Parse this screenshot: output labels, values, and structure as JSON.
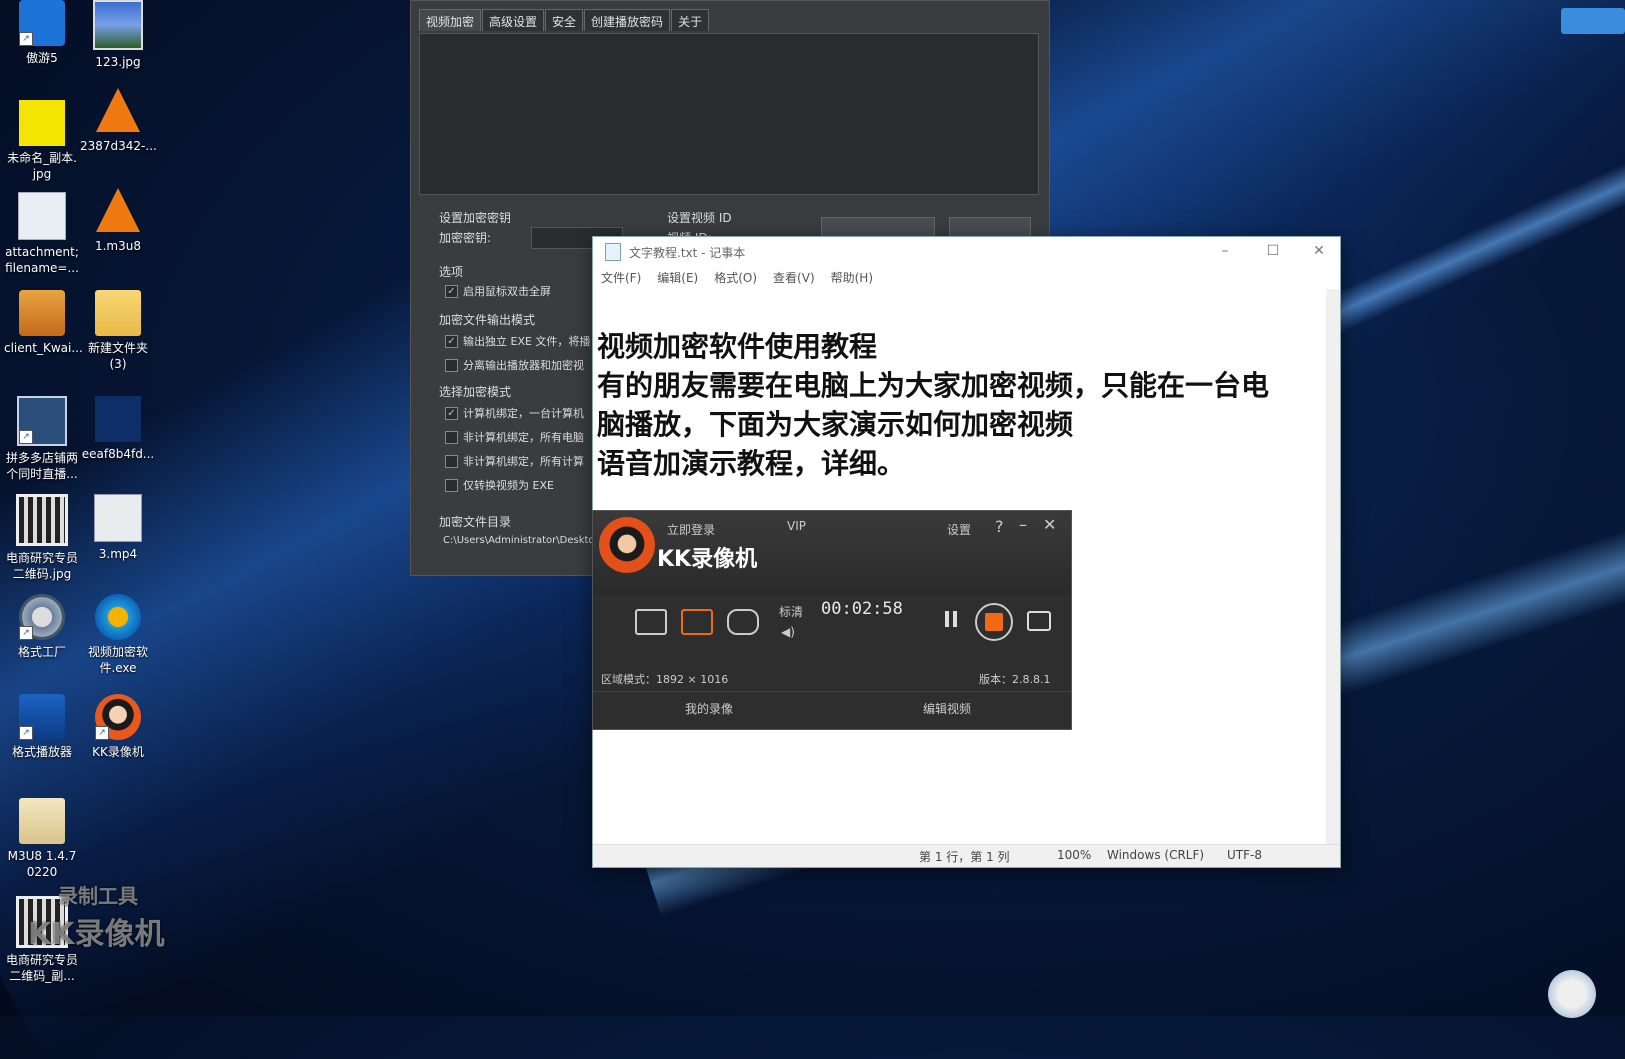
{
  "desktop": {
    "icons": [
      {
        "label": "傲游5",
        "icon": "maxthon-icon"
      },
      {
        "label": "123.jpg",
        "icon": "image-icon"
      },
      {
        "label": "未命名_副本.\njpg",
        "icon": "image-icon"
      },
      {
        "label": "2387d342-...",
        "icon": "vlc-icon"
      },
      {
        "label": "attachment;\nfilename=...",
        "icon": "file-icon"
      },
      {
        "label": "1.m3u8",
        "icon": "vlc-icon"
      },
      {
        "label": "client_Kwai...",
        "icon": "archive-icon"
      },
      {
        "label": "新建文件夹\n(3)",
        "icon": "folder-icon"
      },
      {
        "label": "拼多多店铺两\n个同时直播...",
        "icon": "app-icon"
      },
      {
        "label": "eeaf8b4fd...",
        "icon": "file-icon"
      },
      {
        "label": "电商研究专员\n二维码.jpg",
        "icon": "qr-image-icon"
      },
      {
        "label": "3.mp4",
        "icon": "video-file-icon"
      },
      {
        "label": "格式工厂",
        "icon": "format-factory-icon"
      },
      {
        "label": "视频加密软\n件.exe",
        "icon": "encrypt-app-icon"
      },
      {
        "label": "格式播放器",
        "icon": "player-icon"
      },
      {
        "label": "KK录像机",
        "icon": "kk-recorder-icon"
      },
      {
        "label": "M3U8 1.4.7\n0220",
        "icon": "folder-icon"
      },
      {
        "label": "电商研究专员\n二维码_副...",
        "icon": "qr-image-icon"
      }
    ],
    "watermark": {
      "line1": "录制工具",
      "line2": "KK录像机"
    }
  },
  "encrypt_window": {
    "tabs": [
      "视频加密",
      "高级设置",
      "安全",
      "创建播放密码",
      "关于"
    ],
    "key_section": "设置加密密钥",
    "key_label": "加密密钥:",
    "video_id_section": "设置视频 ID",
    "video_id_label": "视频 ID:",
    "options_section": "选项",
    "opt_fullscreen": "启用鼠标双击全屏",
    "output_section": "加密文件输出模式",
    "out_exe": "输出独立 EXE 文件，将播",
    "out_split": "分离输出播放器和加密视",
    "mode_section": "选择加密模式",
    "mode1": "计算机绑定，一台计算机",
    "mode2": "非计算机绑定，所有电脑",
    "mode3": "非计算机绑定，所有计算",
    "mode4": "仅转换视频为 EXE",
    "dir_section": "加密文件目录",
    "dir_value": "C:\\Users\\Administrator\\Deskto"
  },
  "notepad": {
    "title": "文字教程.txt - 记事本",
    "menu": [
      "文件(F)",
      "编辑(E)",
      "格式(O)",
      "查看(V)",
      "帮助(H)"
    ],
    "lines": [
      "视频加密软件使用教程",
      "有的朋友需要在电脑上为大家加密视频，只能在一台电",
      "脑播放，下面为大家演示如何加密视频",
      "语音加演示教程，详细。"
    ],
    "status": {
      "position": "第 1 行，第 1 列",
      "zoom": "100%",
      "eol": "Windows (CRLF)",
      "encoding": "UTF-8"
    }
  },
  "kk_recorder": {
    "login": "立即登录",
    "vip": "VIP",
    "settings": "设置",
    "help": "?",
    "brand": "KK录像机",
    "quality": "标清",
    "timer": "00:02:58",
    "region": "区域模式：1892 × 1016",
    "version": "版本：2.8.8.1",
    "my_recordings": "我的录像",
    "edit_video": "编辑视频"
  }
}
